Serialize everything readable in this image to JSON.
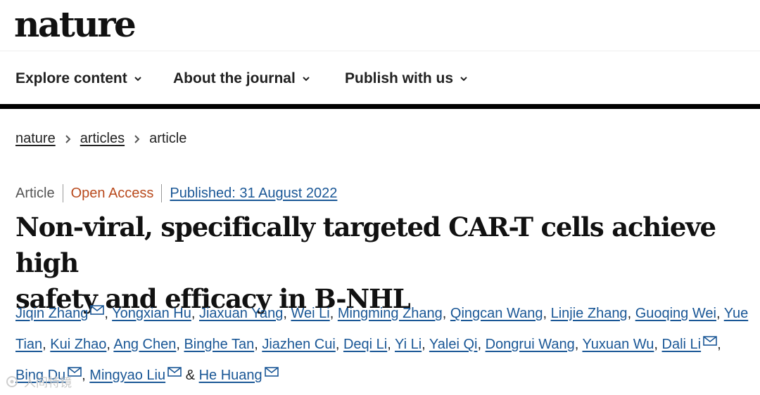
{
  "brand": {
    "logo": "nature"
  },
  "nav": {
    "items": [
      {
        "label": "Explore content"
      },
      {
        "label": "About the journal"
      },
      {
        "label": "Publish with us"
      }
    ]
  },
  "breadcrumb": {
    "items": [
      "nature",
      "articles",
      "article"
    ]
  },
  "meta": {
    "type": "Article",
    "access": "Open Access",
    "published": "Published: 31 August 2022"
  },
  "article": {
    "title_line1": "Non-viral, specifically targeted CAR-T cells achieve high",
    "title_line2": "safety and efficacy in B-NHL"
  },
  "authors": [
    "Jiqin Zhang",
    "Yongxian Hu",
    "Jiaxuan Yang",
    "Wei Li",
    "Mingming Zhang",
    "Qingcan Wang",
    "Linjie Zhang",
    "Guoqing Wei",
    "Yue Tian",
    "Kui Zhao",
    "Ang Chen",
    "Binghe Tan",
    "Jiazhen Cui",
    "Deqi Li",
    "Yi Li",
    "Yalei Qi",
    "Dongrui Wang",
    "Yuxuan Wu",
    "Dali Li",
    "Bing Du",
    "Mingyao Liu",
    "He Huang"
  ],
  "author_joiner": "&",
  "watermark": {
    "text": "人间特镜"
  },
  "icons": {
    "nav_chevron": "chevron-down-icon",
    "breadcrumb_sep": "chevron-right-icon",
    "mail": "mail-icon",
    "watermark": "watermark-logo-icon"
  },
  "colors": {
    "link": "#1a5796",
    "open_access": "#b94a1d",
    "bar": "#000000"
  }
}
